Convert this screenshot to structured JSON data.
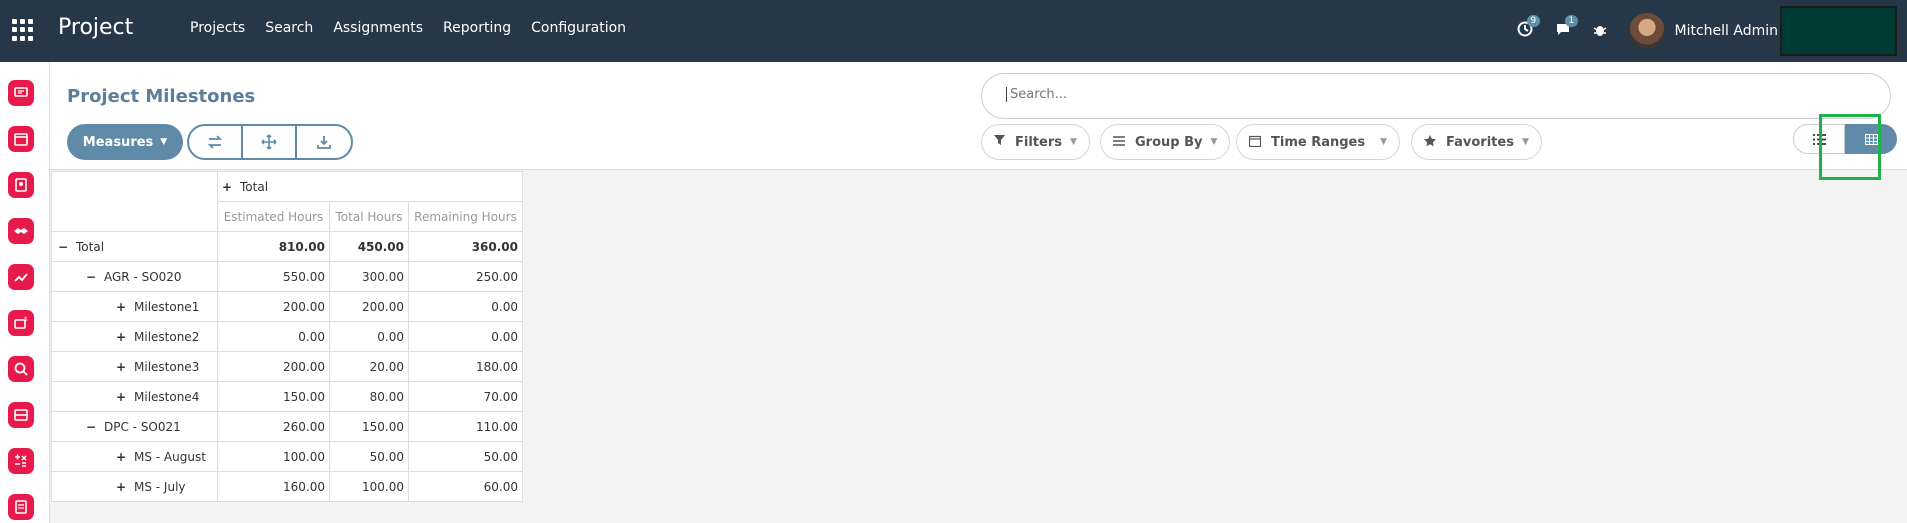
{
  "navbar": {
    "brand": "Project",
    "menu": [
      "Projects",
      "Search",
      "Assignments",
      "Reporting",
      "Configuration"
    ],
    "activity_count": "9",
    "messages_count": "1",
    "user_name": "Mitchell Admin"
  },
  "control_panel": {
    "title": "Project Milestones",
    "search_placeholder": "Search...",
    "measures_label": "Measures",
    "filters_label": "Filters",
    "group_by_label": "Group By",
    "time_ranges_label": "Time Ranges",
    "favorites_label": "Favorites"
  },
  "pivot": {
    "column_header": "Total",
    "measures": [
      "Estimated Hours",
      "Total Hours",
      "Remaining Hours"
    ],
    "rows": [
      {
        "label": "Total",
        "sign": "−",
        "level": 0,
        "values": [
          "810.00",
          "450.00",
          "360.00"
        ]
      },
      {
        "label": "AGR - SO020",
        "sign": "−",
        "level": 1,
        "values": [
          "550.00",
          "300.00",
          "250.00"
        ]
      },
      {
        "label": "Milestone1",
        "sign": "+",
        "level": 2,
        "values": [
          "200.00",
          "200.00",
          "0.00"
        ]
      },
      {
        "label": "Milestone2",
        "sign": "+",
        "level": 2,
        "values": [
          "0.00",
          "0.00",
          "0.00"
        ]
      },
      {
        "label": "Milestone3",
        "sign": "+",
        "level": 2,
        "values": [
          "200.00",
          "20.00",
          "180.00"
        ]
      },
      {
        "label": "Milestone4",
        "sign": "+",
        "level": 2,
        "values": [
          "150.00",
          "80.00",
          "70.00"
        ]
      },
      {
        "label": "DPC - SO021",
        "sign": "−",
        "level": 1,
        "values": [
          "260.00",
          "150.00",
          "110.00"
        ]
      },
      {
        "label": "MS - August",
        "sign": "+",
        "level": 2,
        "values": [
          "100.00",
          "50.00",
          "50.00"
        ]
      },
      {
        "label": "MS - July",
        "sign": "+",
        "level": 2,
        "values": [
          "160.00",
          "100.00",
          "60.00"
        ]
      }
    ]
  },
  "colors": {
    "navbar": "#263747",
    "accent": "#5f8ba8",
    "app_icon": "#e8194b",
    "highlight": "#1fb24a"
  },
  "icons": {
    "apps": "grid-icon",
    "activity": "clock-icon",
    "messages": "chat-icon",
    "debug": "bug-icon",
    "flip_axis": "swap-icon",
    "expand_all": "expand-icon",
    "download": "download-icon",
    "list_view": "list-icon",
    "pivot_view": "table-icon"
  }
}
